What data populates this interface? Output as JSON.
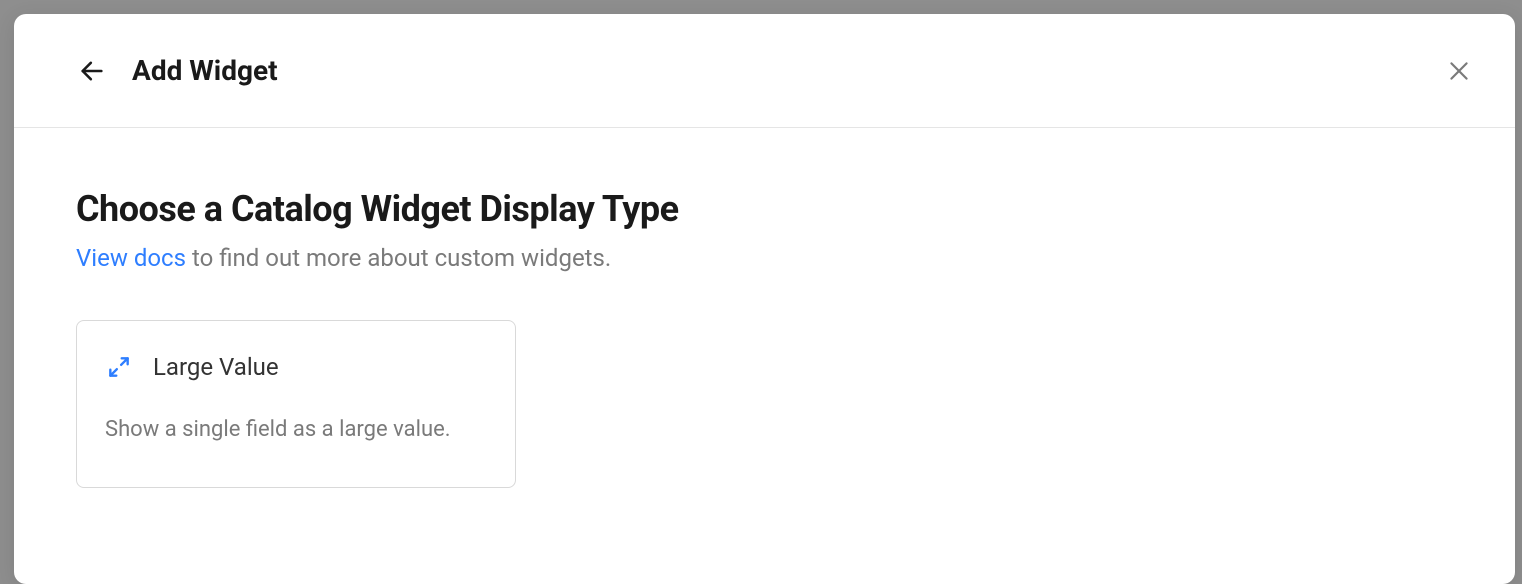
{
  "header": {
    "title": "Add Widget"
  },
  "section": {
    "heading": "Choose a Catalog Widget Display Type",
    "docs_link": "View docs",
    "subtext_rest": " to find out more about custom widgets."
  },
  "cards": [
    {
      "title": "Large Value",
      "description": "Show a single field as a large value."
    }
  ]
}
